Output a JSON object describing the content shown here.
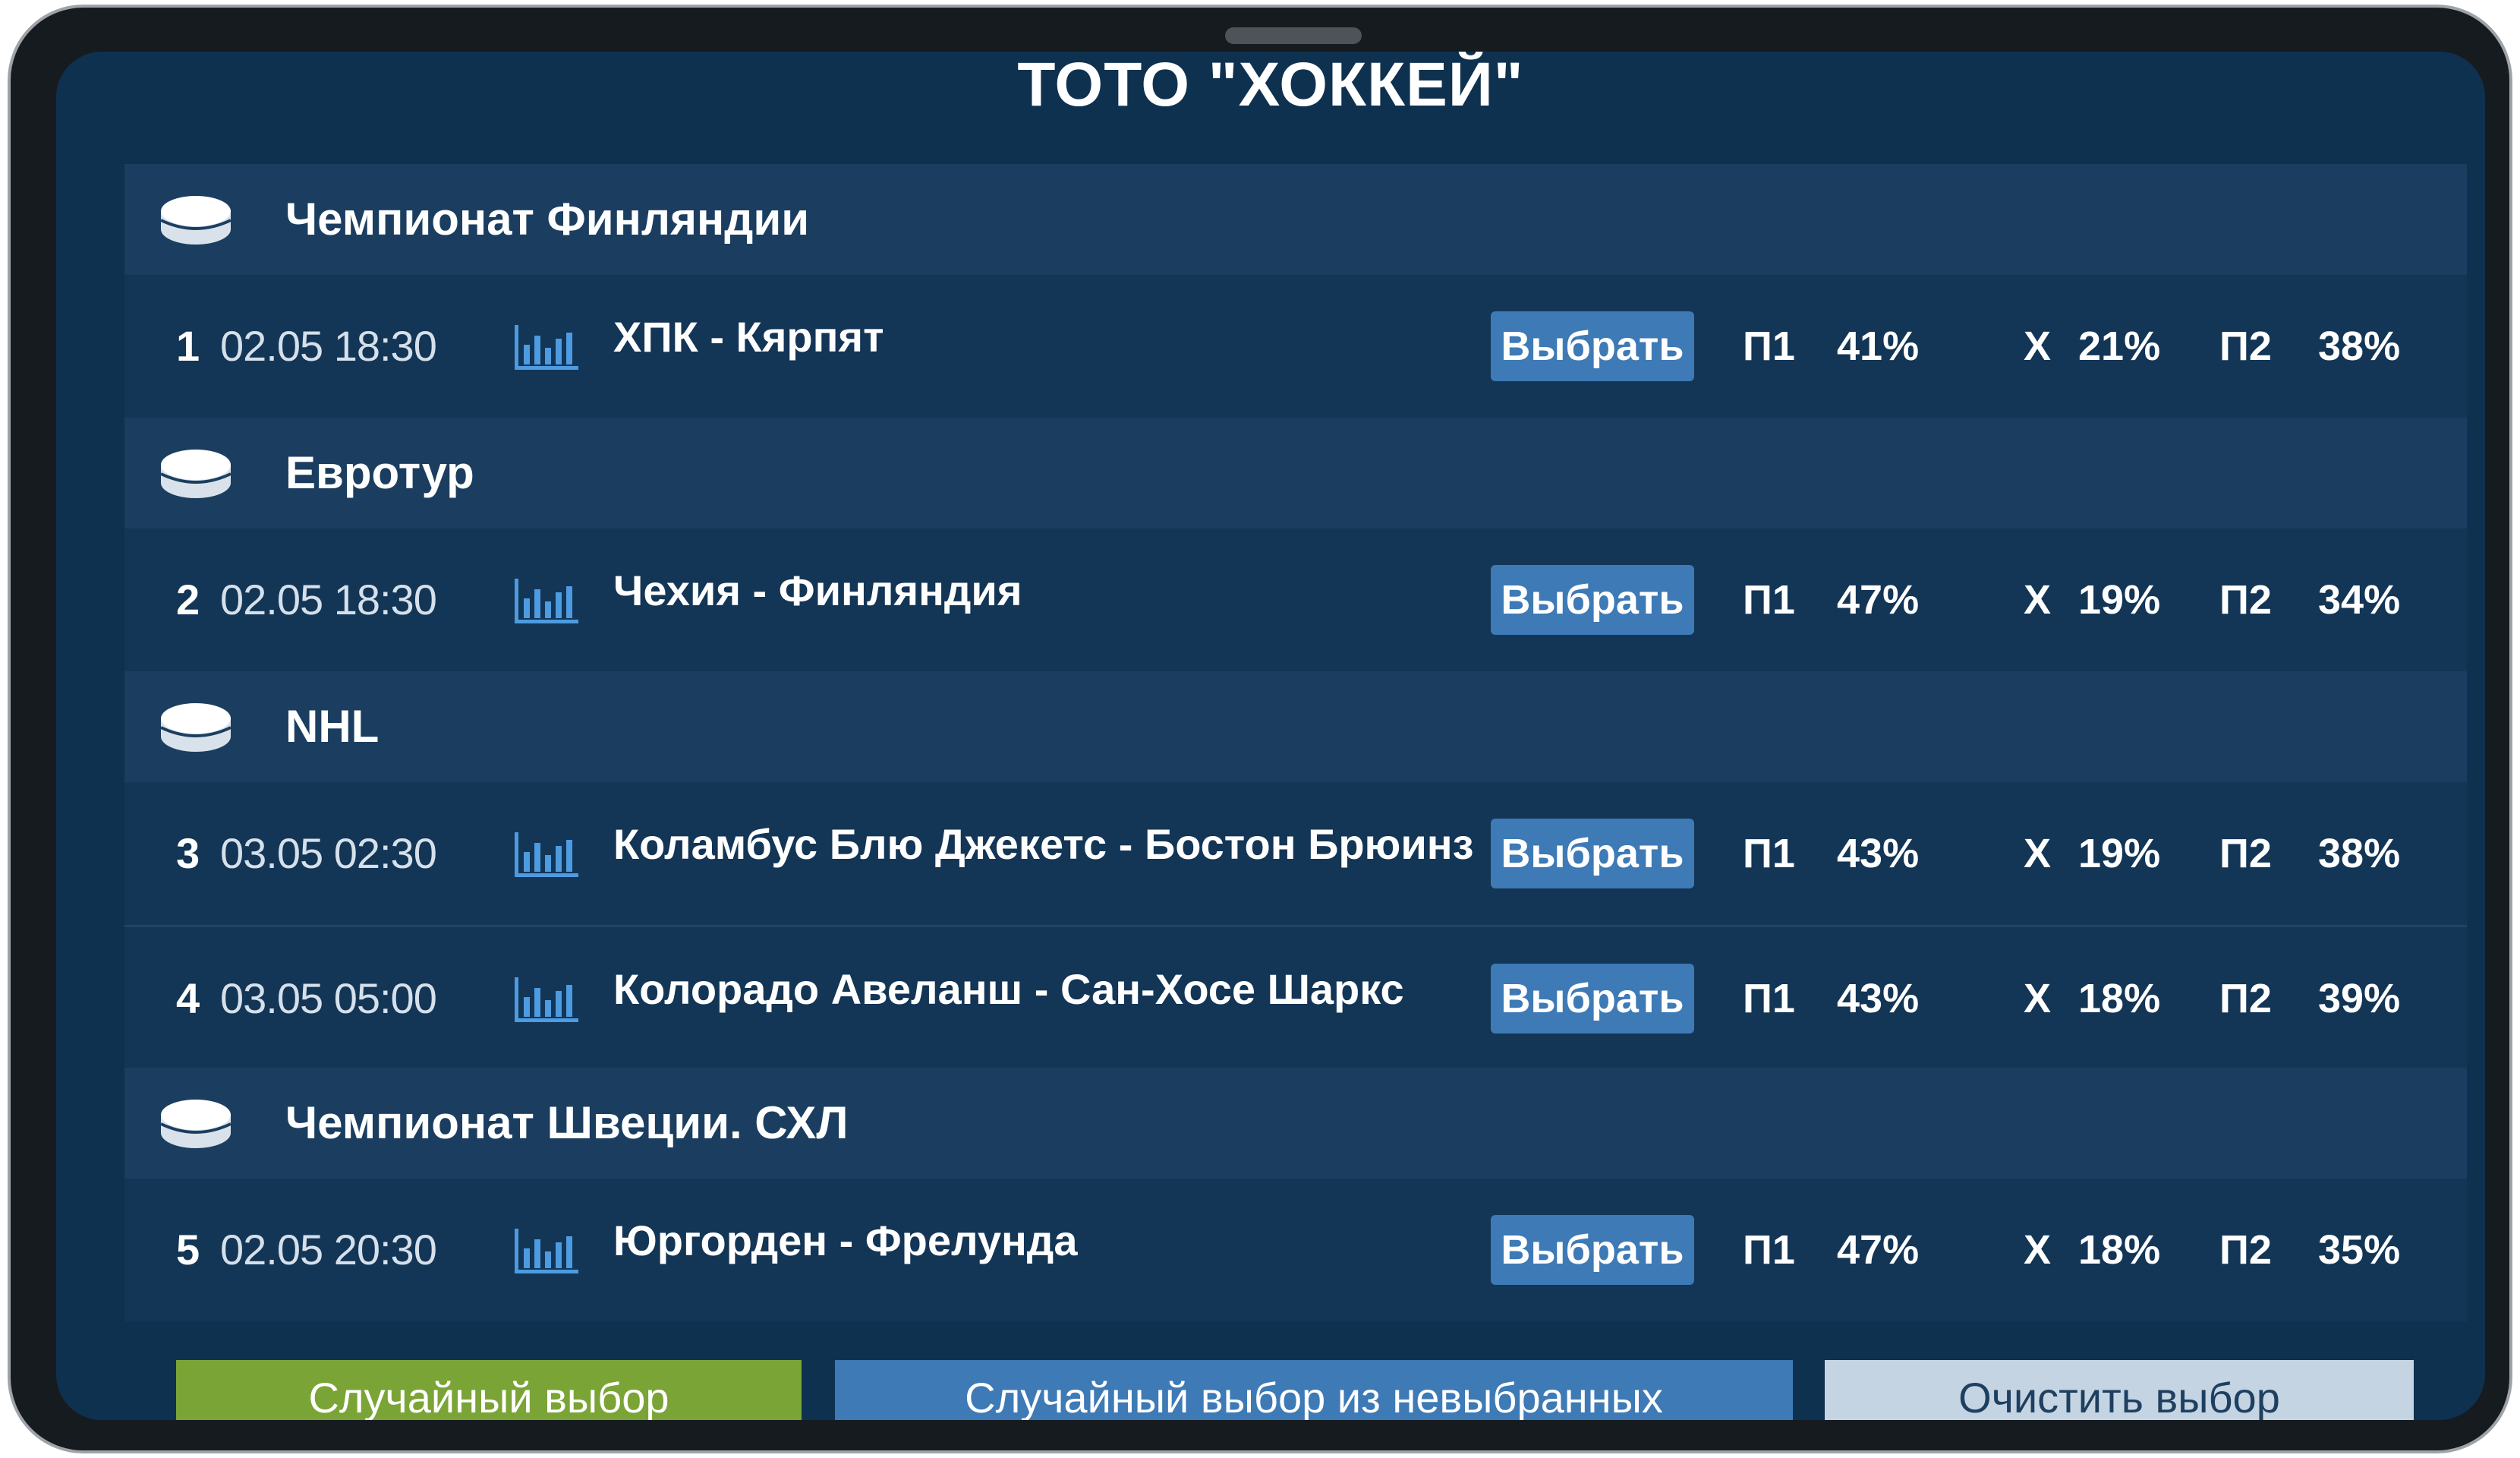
{
  "title": "ТОТО \"ХОККЕЙ\"",
  "select_label": "Выбрать",
  "odds_labels": {
    "p1": "П1",
    "x": "Х",
    "p2": "П2"
  },
  "leagues": [
    {
      "name": "Чемпионат Финляндии"
    },
    {
      "name": "Евротур"
    },
    {
      "name": "NHL"
    },
    {
      "name": "Чемпионат Швеции. СХЛ"
    }
  ],
  "matches": [
    {
      "num": "1",
      "datetime": "02.05 18:30",
      "teams": "ХПК - Кярпят",
      "p1": "41%",
      "x": "21%",
      "p2": "38%"
    },
    {
      "num": "2",
      "datetime": "02.05 18:30",
      "teams": "Чехия - Финляндия",
      "p1": "47%",
      "x": "19%",
      "p2": "34%"
    },
    {
      "num": "3",
      "datetime": "03.05 02:30",
      "teams": "Коламбус Блю Джекетс - Бостон Брюинз",
      "p1": "43%",
      "x": "19%",
      "p2": "38%"
    },
    {
      "num": "4",
      "datetime": "03.05 05:00",
      "teams": "Колорадо Авеланш - Сан-Хосе Шаркс",
      "p1": "43%",
      "x": "18%",
      "p2": "39%"
    },
    {
      "num": "5",
      "datetime": "02.05 20:30",
      "teams": "Юргорден - Фрелунда",
      "p1": "47%",
      "x": "18%",
      "p2": "35%"
    }
  ],
  "buttons": {
    "random": "Случайный выбор",
    "random_unselected": "Случайный выбор из невыбранных",
    "clear": "Очистить выбор"
  },
  "icons": {
    "league": "hockey-puck-icon",
    "stats": "bar-chart-icon"
  },
  "colors": {
    "background": "#0f3150",
    "league_bar": "#1b3e60",
    "select_button": "#3d7ab6",
    "random_button": "#7ba436",
    "clear_button": "#c4d4e2"
  }
}
